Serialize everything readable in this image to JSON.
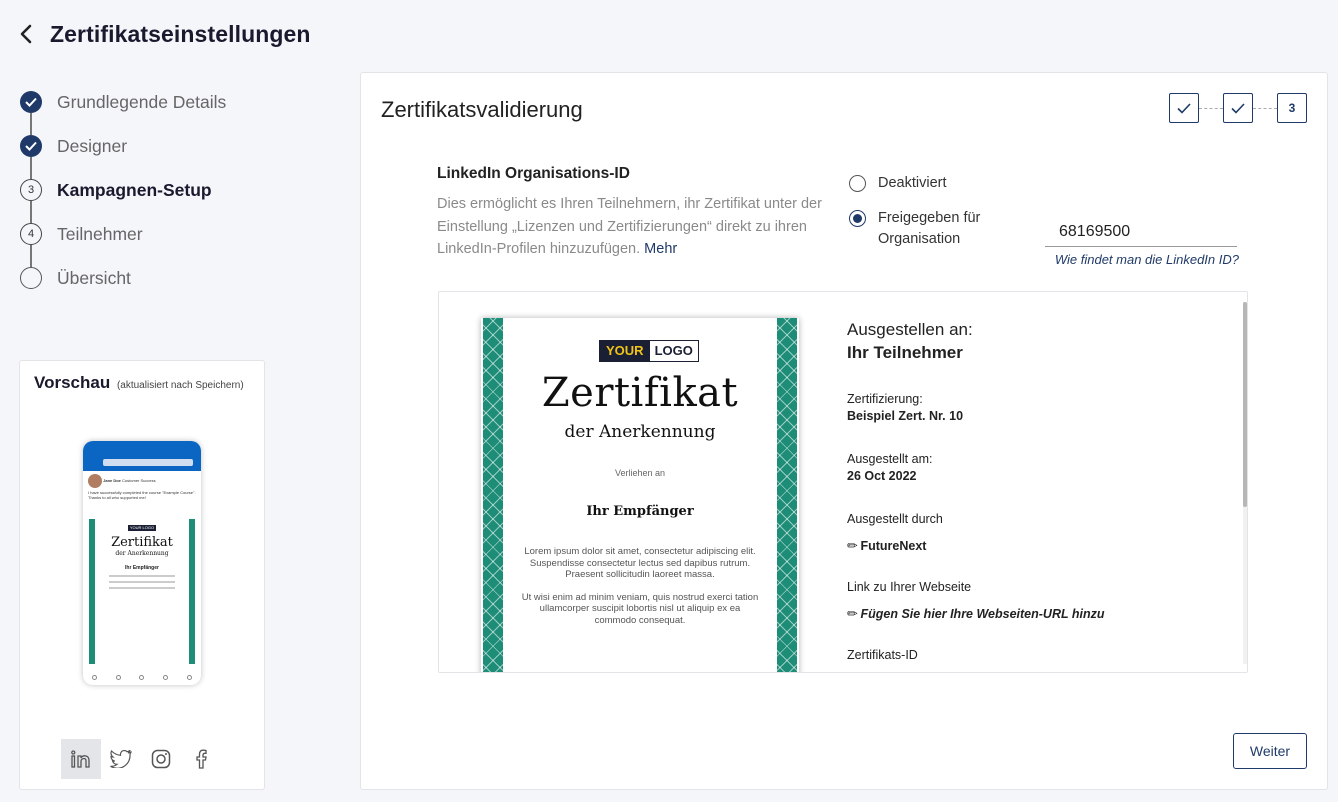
{
  "header": {
    "title": "Zertifikatseinstellungen"
  },
  "steps": [
    {
      "label": "Grundlegende Details",
      "state": "done"
    },
    {
      "label": "Designer",
      "state": "done"
    },
    {
      "label": "Kampagnen-Setup",
      "state": "active",
      "number": "3"
    },
    {
      "label": "Teilnehmer",
      "state": "pending",
      "number": "4"
    },
    {
      "label": "Übersicht",
      "state": "pending"
    }
  ],
  "preview": {
    "title": "Vorschau",
    "note": "(aktualisiert nach Speichern)",
    "phone": {
      "user_name": "Jane Doe",
      "user_sub": "Customer Success",
      "post_text": "I have successfully completed the course \"Example Course\". Thanks to all who supported me!",
      "cert_logo": "YOUR LOGO",
      "cert_title": "Zertifikat",
      "cert_sub": "der Anerkennung",
      "cert_name": "Ihr Empfänger"
    },
    "social": [
      "linkedin-icon",
      "twitter-icon",
      "instagram-icon",
      "facebook-icon"
    ]
  },
  "main": {
    "title": "Zertifikatsvalidierung",
    "mini_steps": [
      "",
      "",
      "3"
    ],
    "linkedin": {
      "title": "LinkedIn Organisations-ID",
      "description": "Dies ermöglicht es Ihren Teilnehmern, ihr Zertifikat unter der Einstellung „Lizenzen und Zertifizierungen“ direkt zu ihren LinkedIn-Profilen hinzuzufügen.",
      "more": "Mehr"
    },
    "radio": {
      "option1": "Deaktiviert",
      "option2": "Freigegeben für Organisation",
      "selected": "option2"
    },
    "org_id": "68169500",
    "help_link": "Wie findet man die LinkedIn ID?",
    "certificate": {
      "logo_a": "YOUR",
      "logo_b": "LOGO",
      "title": "Zertifikat",
      "subtitle": "der Anerkennung",
      "given": "Verliehen an",
      "recipient": "Ihr Empfänger",
      "lorem1": "Lorem ipsum dolor sit amet, consectetur adipiscing elit. Suspendisse consectetur lectus sed dapibus rutrum. Praesent sollicitudin laoreet massa.",
      "lorem2": "Ut wisi enim ad minim veniam, quis nostrud exerci tation ullamcorper suscipit lobortis nisl ut aliquip ex ea commodo consequat."
    },
    "info": {
      "issued_to_label": "Ausgestellen an:",
      "issued_to_value": "Ihr Teilnehmer",
      "certification_label": "Zertifizierung:",
      "certification_value": "Beispiel Zert. Nr. 10",
      "issued_on_label": "Ausgestellt am:",
      "issued_on_value": "26 Oct 2022",
      "issued_by_label": "Ausgestellt durch",
      "issued_by_value": "FutureNext",
      "website_label": "Link zu Ihrer Webseite",
      "website_value": "Fügen Sie hier Ihre Webseiten-URL hinzu",
      "cert_id_label": "Zertifikats-ID"
    },
    "next_button": "Weiter"
  }
}
